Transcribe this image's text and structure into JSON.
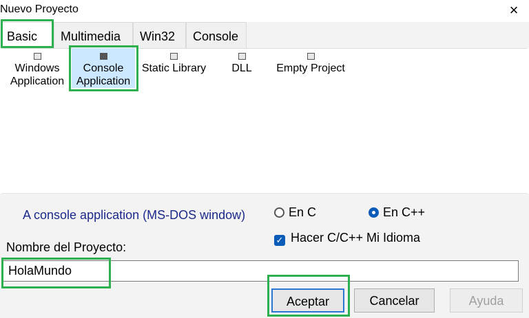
{
  "window": {
    "title": "Nuevo Proyecto",
    "close_icon": "×"
  },
  "tabs": [
    {
      "label": "Basic",
      "active": true
    },
    {
      "label": "Multimedia",
      "active": false
    },
    {
      "label": "Win32",
      "active": false
    },
    {
      "label": "Console",
      "active": false
    }
  ],
  "templates": [
    {
      "line1": "Windows",
      "line2": "Application",
      "icon": "window-app-icon"
    },
    {
      "line1": "Console",
      "line2": "Application",
      "icon": "console-app-icon",
      "selected": true
    },
    {
      "line1": "Static Library",
      "line2": "",
      "icon": "static-library-icon"
    },
    {
      "line1": "DLL",
      "line2": "",
      "icon": "dll-icon"
    },
    {
      "line1": "Empty Project",
      "line2": "",
      "icon": "empty-project-icon"
    }
  ],
  "description": "A console application (MS-DOS window)",
  "language": {
    "options": [
      "En C",
      "En C++"
    ],
    "selected": "En C++"
  },
  "checkbox": {
    "label": "Hacer C/C++ Mi Idioma",
    "checked": true
  },
  "project_name": {
    "label": "Nombre del Proyecto:",
    "value": "HolaMundo"
  },
  "buttons": {
    "accept": "Aceptar",
    "cancel": "Cancelar",
    "help": "Ayuda"
  },
  "colors": {
    "highlight": "#2fb04f",
    "selection": "#cce8ff",
    "accent": "#0b5cb8",
    "description_text": "#1b2a8a"
  }
}
